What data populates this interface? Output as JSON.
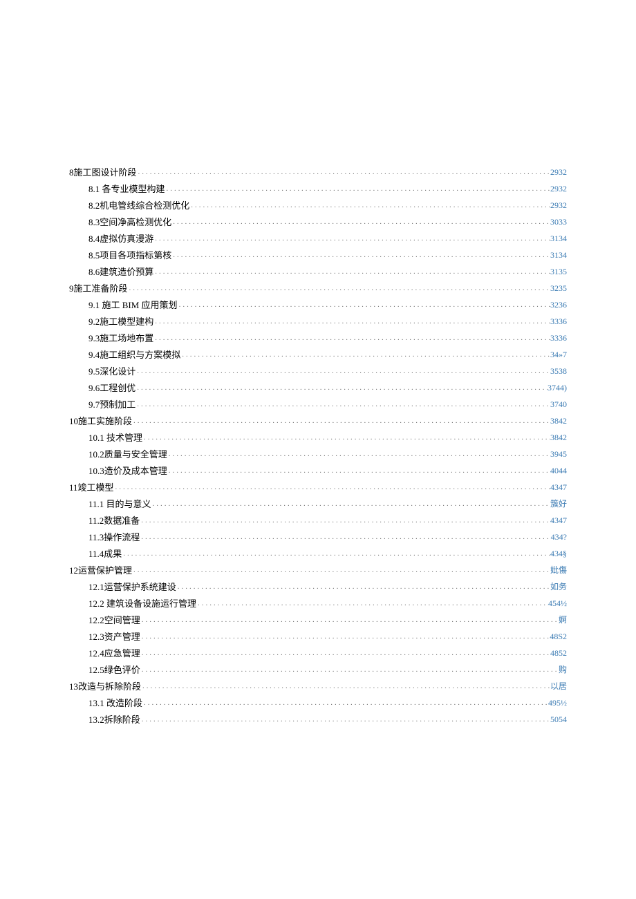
{
  "toc": [
    {
      "lvl": 0,
      "num": "8",
      "title": " 施工图设计阶段 ",
      "pg": "2932"
    },
    {
      "lvl": 1,
      "num": "8.",
      "title": "    1 各专业模型构建 ",
      "pg": "2932"
    },
    {
      "lvl": 1,
      "num": "8.2",
      "title": " 机电管线综合检测优化 ",
      "pg": "2932"
    },
    {
      "lvl": 1,
      "num": "8.3",
      "title": " 空间净高检测优化 ",
      "pg": "3033"
    },
    {
      "lvl": 1,
      "num": "8.4",
      "title": " 虚拟仿真漫游 ",
      "pg": "3134"
    },
    {
      "lvl": 1,
      "num": "8.5",
      "title": " 项目各项指标第核 ",
      "pg": "3134"
    },
    {
      "lvl": 1,
      "num": "8.6",
      "title": " 建筑造价预算 ",
      "pg": "3135"
    },
    {
      "lvl": 0,
      "num": "9",
      "title": " 施工准备阶段 ",
      "pg": "3235"
    },
    {
      "lvl": 1,
      "num": "9.",
      "title": "    1 施工 BIM 应用策划 ",
      "pg": "3236"
    },
    {
      "lvl": 1,
      "num": "9.2",
      "title": " 施工模型建构 ",
      "pg": "3336"
    },
    {
      "lvl": 1,
      "num": "9.3",
      "title": " 施工场地布置 ",
      "pg": "3336"
    },
    {
      "lvl": 1,
      "num": "9.4",
      "title": " 施工组织与方案模拟 ",
      "pg": "34»7"
    },
    {
      "lvl": 1,
      "num": "9.5",
      "title": " 深化设计 ",
      "pg": "3538"
    },
    {
      "lvl": 1,
      "num": "9.6",
      "title": " 工程创优 ",
      "pg": "3744)"
    },
    {
      "lvl": 1,
      "num": "9.7",
      "title": " 预制加工 ",
      "pg": "3740"
    },
    {
      "lvl": 0,
      "num": "10",
      "title": " 施工实施阶段 ",
      "pg": "3842"
    },
    {
      "lvl": 1,
      "num": "10.",
      "title": "    1 技术管理 ",
      "pg": "3842"
    },
    {
      "lvl": 1,
      "num": "10.2",
      "title": " 质量与安全管理 ",
      "pg": "3945"
    },
    {
      "lvl": 1,
      "num": "10.3",
      "title": " 造价及成本管理 ",
      "pg": "4044"
    },
    {
      "lvl": 0,
      "num": "11",
      "title": " 竣工模型 ",
      "pg": "4347"
    },
    {
      "lvl": 1,
      "num": "11.",
      "title": "    1 目的与意义 ",
      "pg": "簇好"
    },
    {
      "lvl": 1,
      "num": "11.2",
      "title": "      数据准备 ",
      "pg": "4347"
    },
    {
      "lvl": 1,
      "num": "11.3",
      "title": "      操作流程 ",
      "pg": "434?"
    },
    {
      "lvl": 1,
      "num": "11.4",
      "title": "      成果 ",
      "pg": "434§"
    },
    {
      "lvl": 0,
      "num": "12",
      "title": " 运营保护管理 ",
      "pg": "妣傷"
    },
    {
      "lvl": 1,
      "num": "12.1",
      "title": "      运营保护系统建设 ",
      "pg": "如务"
    },
    {
      "lvl": 1,
      "num": "12.",
      "title": "    2 建筑设备设施运行管理 ",
      "pg": "454½"
    },
    {
      "lvl": 1,
      "num": "12.2",
      "title": "      空间管理 ",
      "pg": "婀"
    },
    {
      "lvl": 1,
      "num": "12.3",
      "title": "      资产管理 ",
      "pg": "48S2"
    },
    {
      "lvl": 1,
      "num": "12.4",
      "title": "      应急管理 ",
      "pg": "4852"
    },
    {
      "lvl": 1,
      "num": "12.5",
      "title": "      绿色评价 ",
      "pg": "购"
    },
    {
      "lvl": 0,
      "num": "13",
      "title": " 改造与拆除阶段 ",
      "pg": "以居"
    },
    {
      "lvl": 1,
      "num": "13.",
      "title": "    1 改造阶段 ",
      "pg": "495½"
    },
    {
      "lvl": 1,
      "num": "13.2",
      "title": " 拆除阶段 ",
      "pg": "5054"
    }
  ]
}
